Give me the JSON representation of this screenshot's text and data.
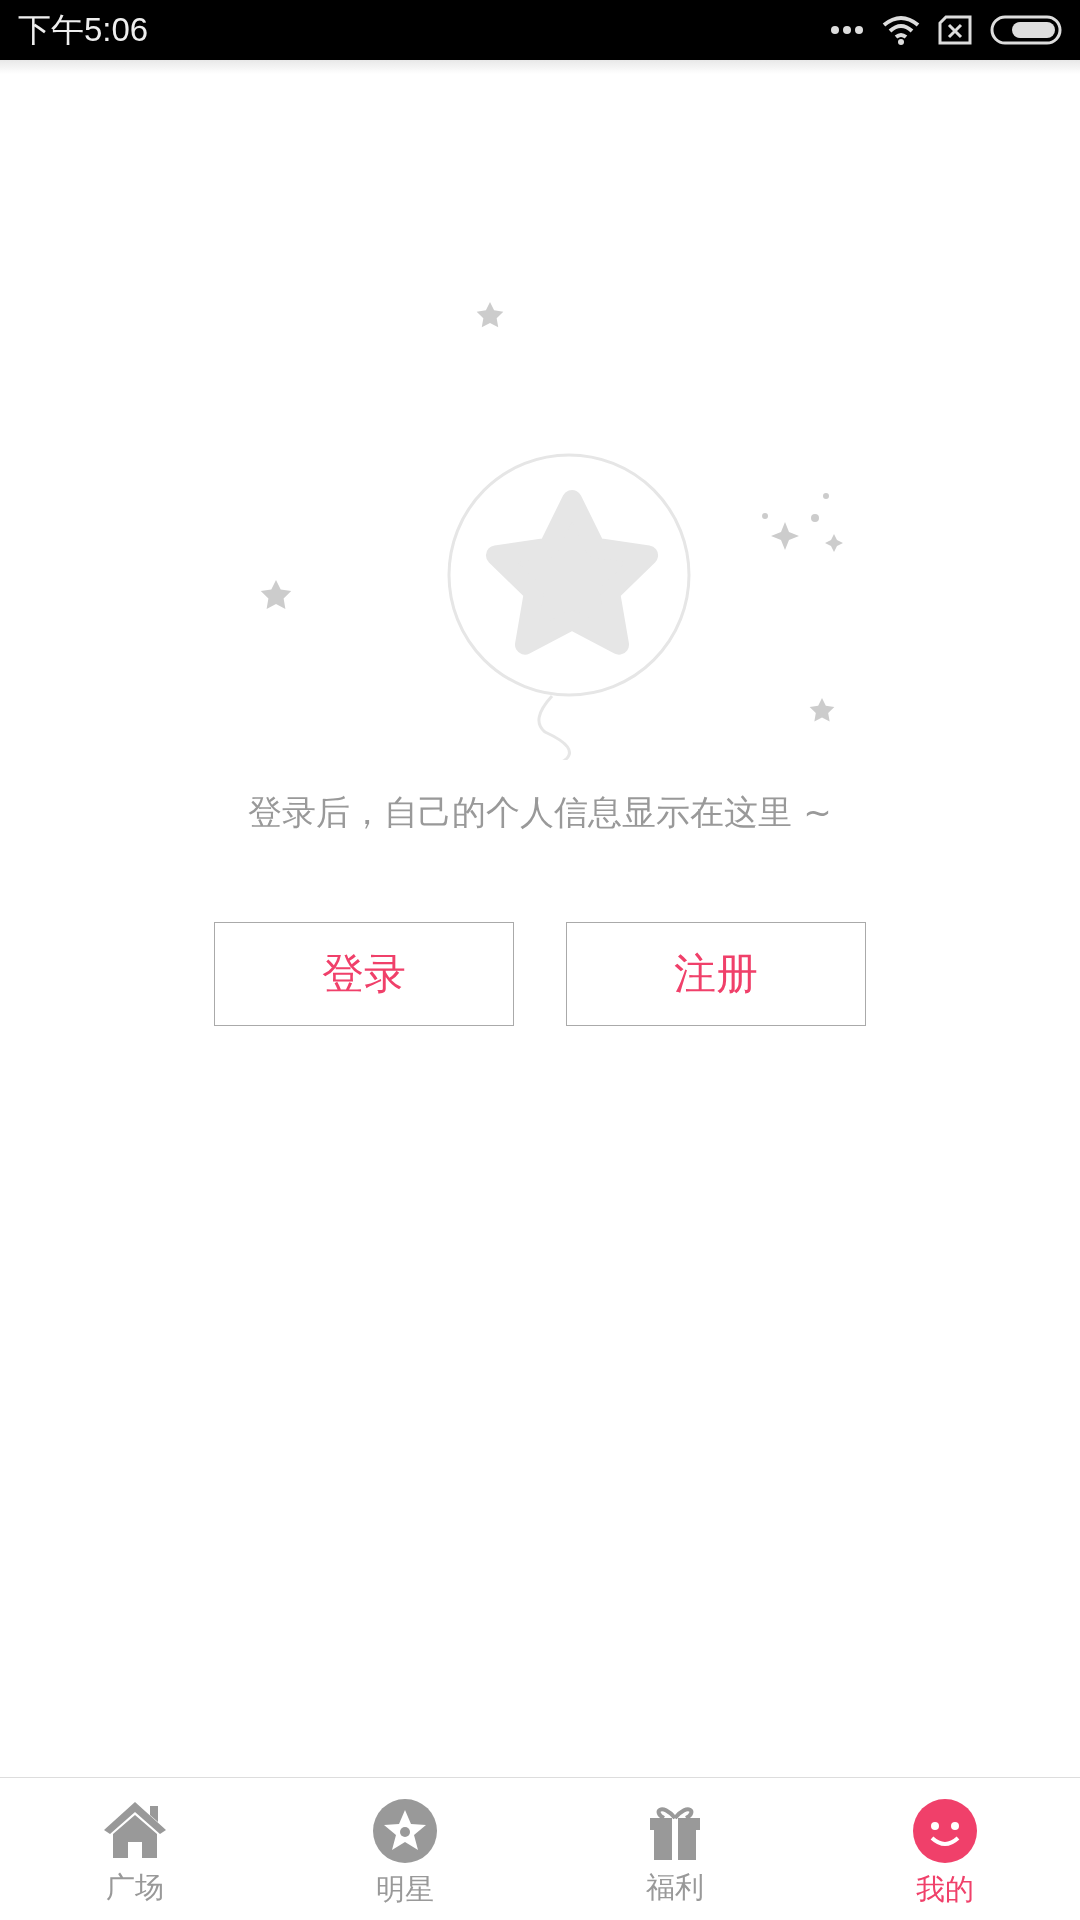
{
  "status_bar": {
    "time": "下午5:06"
  },
  "empty_state": {
    "message": "登录后，自己的个人信息显示在这里 ~"
  },
  "buttons": [
    {
      "label": "登录"
    },
    {
      "label": "注册"
    }
  ],
  "tab_bar": [
    {
      "label": "广场",
      "kind": "home",
      "selected": false
    },
    {
      "label": "明星",
      "kind": "star",
      "selected": false
    },
    {
      "label": "福利",
      "kind": "gift",
      "selected": false
    },
    {
      "label": "我的",
      "kind": "me",
      "selected": true
    }
  ]
}
